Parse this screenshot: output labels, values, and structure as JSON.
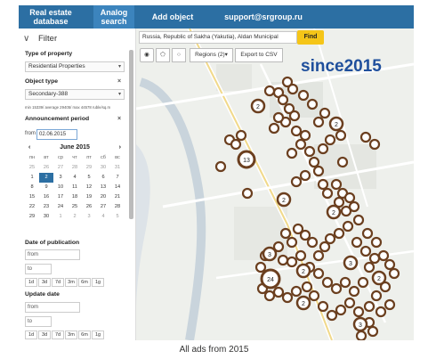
{
  "nav": {
    "real_estate": "Real estate database",
    "analog": "Analog search",
    "add_object": "Add object",
    "support": "support@srgroup.ru"
  },
  "search": {
    "value": "Russia, Republic of Sakha (Yakutia), Aldan Municipal",
    "find_label": "Find"
  },
  "tools": {
    "regions_label": "Regions (2)▾",
    "export_label": "Export to CSV"
  },
  "overlay_text": "since2015",
  "filter": {
    "title": "Filter",
    "type_of_property_label": "Type of property",
    "type_of_property_value": "Residential Properties",
    "object_type_label": "Object type",
    "object_type_value": "Secondary-388",
    "price_note": "min 15339/ average 29405/ max 44578 ruble/sq.m",
    "announcement_label": "Announcement period",
    "from_label": "from",
    "from_value": "02.06.2015",
    "calendar": {
      "month": "June 2015",
      "weekdays": [
        "пн",
        "вт",
        "ср",
        "чт",
        "пт",
        "сб",
        "вс"
      ],
      "days": [
        [
          "25",
          "26",
          "27",
          "28",
          "29",
          "30",
          "31"
        ],
        [
          "1",
          "2",
          "3",
          "4",
          "5",
          "6",
          "7"
        ],
        [
          "8",
          "9",
          "10",
          "11",
          "12",
          "13",
          "14"
        ],
        [
          "15",
          "16",
          "17",
          "18",
          "19",
          "20",
          "21"
        ],
        [
          "22",
          "23",
          "24",
          "25",
          "26",
          "27",
          "28"
        ],
        [
          "29",
          "30",
          "1",
          "2",
          "3",
          "4",
          "5"
        ]
      ]
    },
    "date_of_publication_label": "Date of publication",
    "to_label": "to",
    "quick": [
      "1d",
      "3d",
      "7d",
      "3m",
      "6m",
      "1g"
    ],
    "update_date_label": "Update date"
  },
  "map_markers": [
    "2",
    "2",
    "13",
    "2",
    "24",
    "3",
    "2",
    "3",
    "3",
    "2",
    "2",
    "2"
  ],
  "caption": "All ads from 2015"
}
